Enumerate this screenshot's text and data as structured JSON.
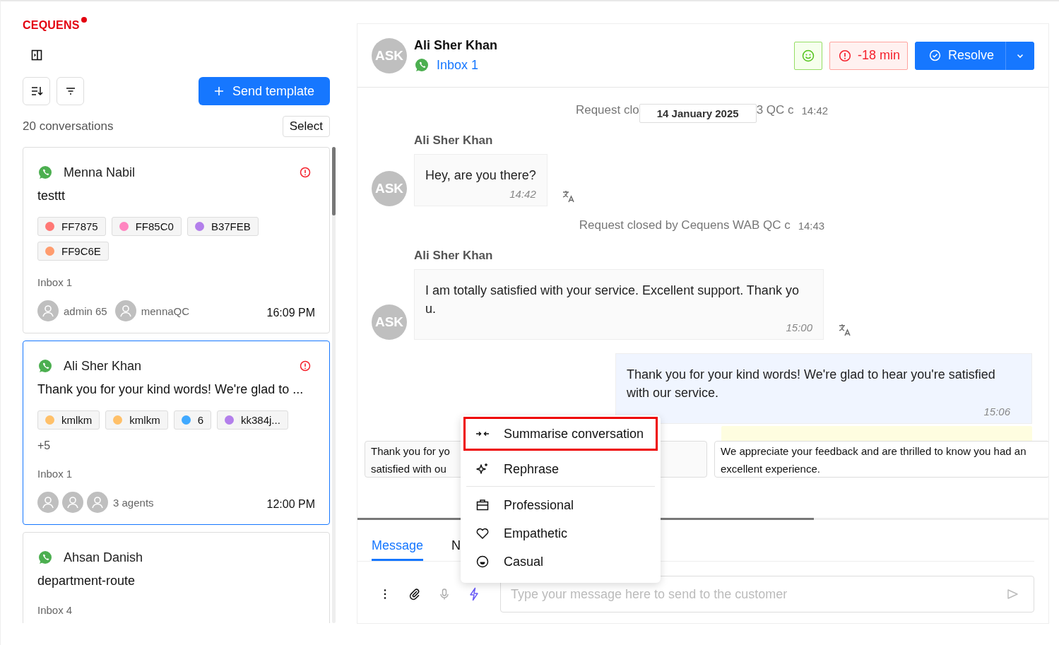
{
  "brand": {
    "logo": "CEQUENS"
  },
  "sidebar": {
    "send_template": "Send template",
    "count": "20 conversations",
    "select": "Select",
    "conversations": [
      {
        "name": "Menna Nabil",
        "preview": "testtt",
        "selected": false,
        "alert": true,
        "tags": [
          {
            "label": "FF7875",
            "color": "#ff7875"
          },
          {
            "label": "FF85C0",
            "color": "#ff85c0"
          },
          {
            "label": "B37FEB",
            "color": "#b37feb"
          },
          {
            "label": "FF9C6E",
            "color": "#ff9c6e"
          }
        ],
        "inbox": "Inbox 1",
        "agents": [
          {
            "name": "admin 65"
          },
          {
            "name": "mennaQC"
          }
        ],
        "time": "16:09 PM"
      },
      {
        "name": "Ali Sher Khan",
        "preview": "Thank you for your kind words! We're glad to ...",
        "selected": true,
        "alert": true,
        "tags": [
          {
            "label": "kmlkm",
            "color": "#ffc069"
          },
          {
            "label": "kmlkm",
            "color": "#ffc069"
          },
          {
            "label": "6",
            "color": "#40a9ff"
          },
          {
            "label": "kk384j...",
            "color": "#b37feb"
          }
        ],
        "more": "+5",
        "inbox": "Inbox 1",
        "agents": [
          {
            "kind": "avatar"
          },
          {
            "kind": "avatar"
          },
          {
            "kind": "avatar"
          }
        ],
        "agents_label": "3 agents",
        "time": "12:00 PM"
      },
      {
        "name": "Ahsan Danish",
        "preview": "department-route",
        "selected": false,
        "alert": false,
        "inbox": "Inbox 4"
      }
    ]
  },
  "chat": {
    "contact": {
      "initials": "ASK",
      "name": "Ali Sher Khan",
      "inbox": "Inbox 1"
    },
    "timer": "-18 min",
    "resolve": "Resolve",
    "messages": [
      {
        "kind": "system",
        "text": "Request clo",
        "text_after": "3 QC c",
        "date": "14 January 2025",
        "time": "14:42"
      },
      {
        "kind": "incoming",
        "sender": "Ali Sher Khan",
        "initials": "ASK",
        "text": "Hey, are you there?",
        "time": "14:42"
      },
      {
        "kind": "system",
        "text": "Request closed by Cequens WAB QC c",
        "time": "14:43"
      },
      {
        "kind": "incoming",
        "sender": "Ali Sher Khan",
        "initials": "ASK",
        "text": "I am totally satisfied with your service. Excellent support. Thank yo u.",
        "time": "15:00"
      },
      {
        "kind": "outgoing",
        "text": "Thank you for your kind words! We're glad to hear you're satisfied with our service.",
        "time": "15:06"
      }
    ],
    "suggestions": [
      {
        "kind": "text",
        "text": "Thank you for yo satisfied with ou"
      },
      {
        "kind": "covered"
      },
      {
        "kind": "text",
        "text": "We appreciate your feedback and are thrilled to know you had an excellent experience."
      }
    ],
    "tabs": [
      {
        "label": "Message",
        "selected": true
      },
      {
        "label": "N",
        "selected": false
      }
    ],
    "composer": {
      "placeholder": "Type your message here to send to the customer"
    },
    "ai_menu": [
      {
        "label": "Summarise conversation",
        "kind": "summarise",
        "selected": true
      },
      {
        "label": "Rephrase",
        "kind": "rephrase",
        "selected": false
      },
      {
        "label": "Professional",
        "kind": "professional",
        "selected": false
      },
      {
        "label": "Empathetic",
        "kind": "empathetic",
        "selected": false
      },
      {
        "label": "Casual",
        "kind": "casual",
        "selected": false
      }
    ]
  }
}
